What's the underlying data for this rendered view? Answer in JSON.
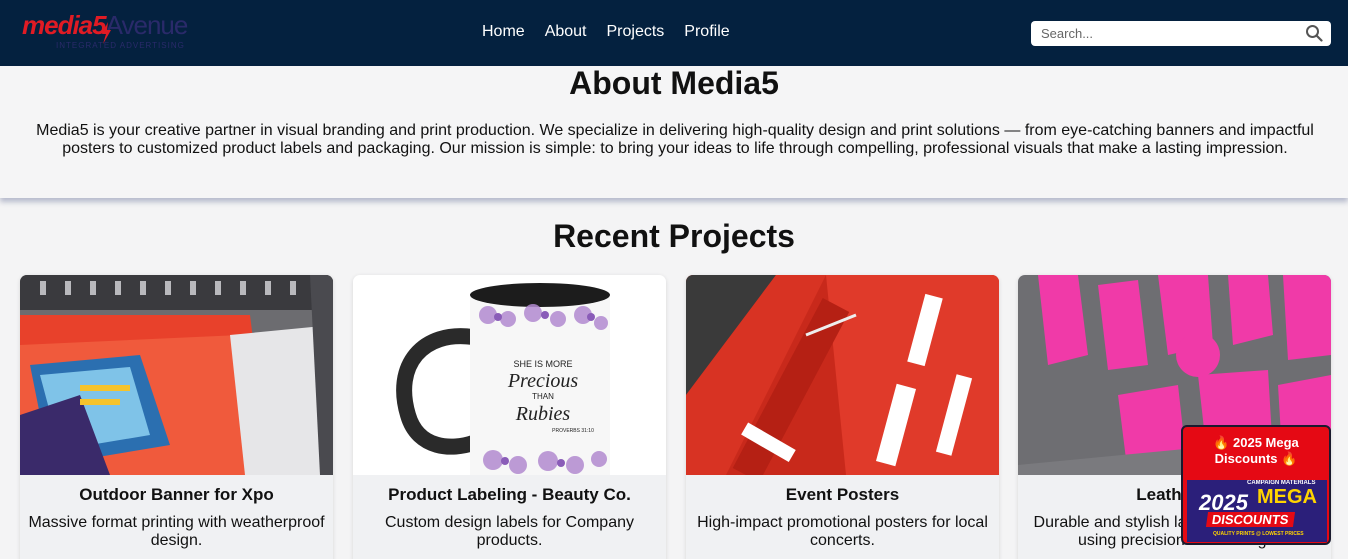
{
  "header": {
    "logo_text_main": "media",
    "logo_text_accent": "5",
    "logo_text_secondary": "Avenue",
    "logo_tagline": "INTEGRATED ADVERTISING",
    "nav": [
      "Home",
      "About",
      "Projects",
      "Profile"
    ],
    "search_placeholder": "Search..."
  },
  "about": {
    "title": "About Media5",
    "text": "Media5 is your creative partner in visual branding and print production. We specialize in delivering high-quality design and print solutions — from eye-catching banners and impactful posters to customized product labels and packaging. Our mission is simple: to bring your ideas to life through compelling, professional visuals that make a lasting impression."
  },
  "projects": {
    "title": "Recent Projects",
    "cards": [
      {
        "title": "Outdoor Banner for Xpo",
        "description": "Massive format printing with weatherproof design.",
        "image": "banner-printer-image"
      },
      {
        "title": "Product Labeling - Beauty Co.",
        "description": "Custom design labels for Company products.",
        "image": "mug-label-image",
        "mug_text": [
          "SHE IS MORE",
          "Precious",
          "THAN",
          "Rubies",
          "PROVERBS 31:10"
        ]
      },
      {
        "title": "Event Posters",
        "description": "High-impact promotional posters for local concerts.",
        "image": "red-poster-image"
      },
      {
        "title": "Leather L",
        "description": "Durable and stylish lab and accessories using precision embossing.",
        "image": "pink-letters-image"
      }
    ]
  },
  "promo": {
    "title": "🔥 2025 Mega Discounts 🔥",
    "image_year": "2025",
    "image_campaign": "CAMPAIGN MATERIALS",
    "image_mega": "MEGA",
    "image_discounts": "DISCOUNTS",
    "image_small": "QUALITY PRINTS @ LOWEST PRICES"
  },
  "colors": {
    "header_bg": "#04213f",
    "accent_red": "#e01b24",
    "page_bg": "#f4f4f5"
  }
}
